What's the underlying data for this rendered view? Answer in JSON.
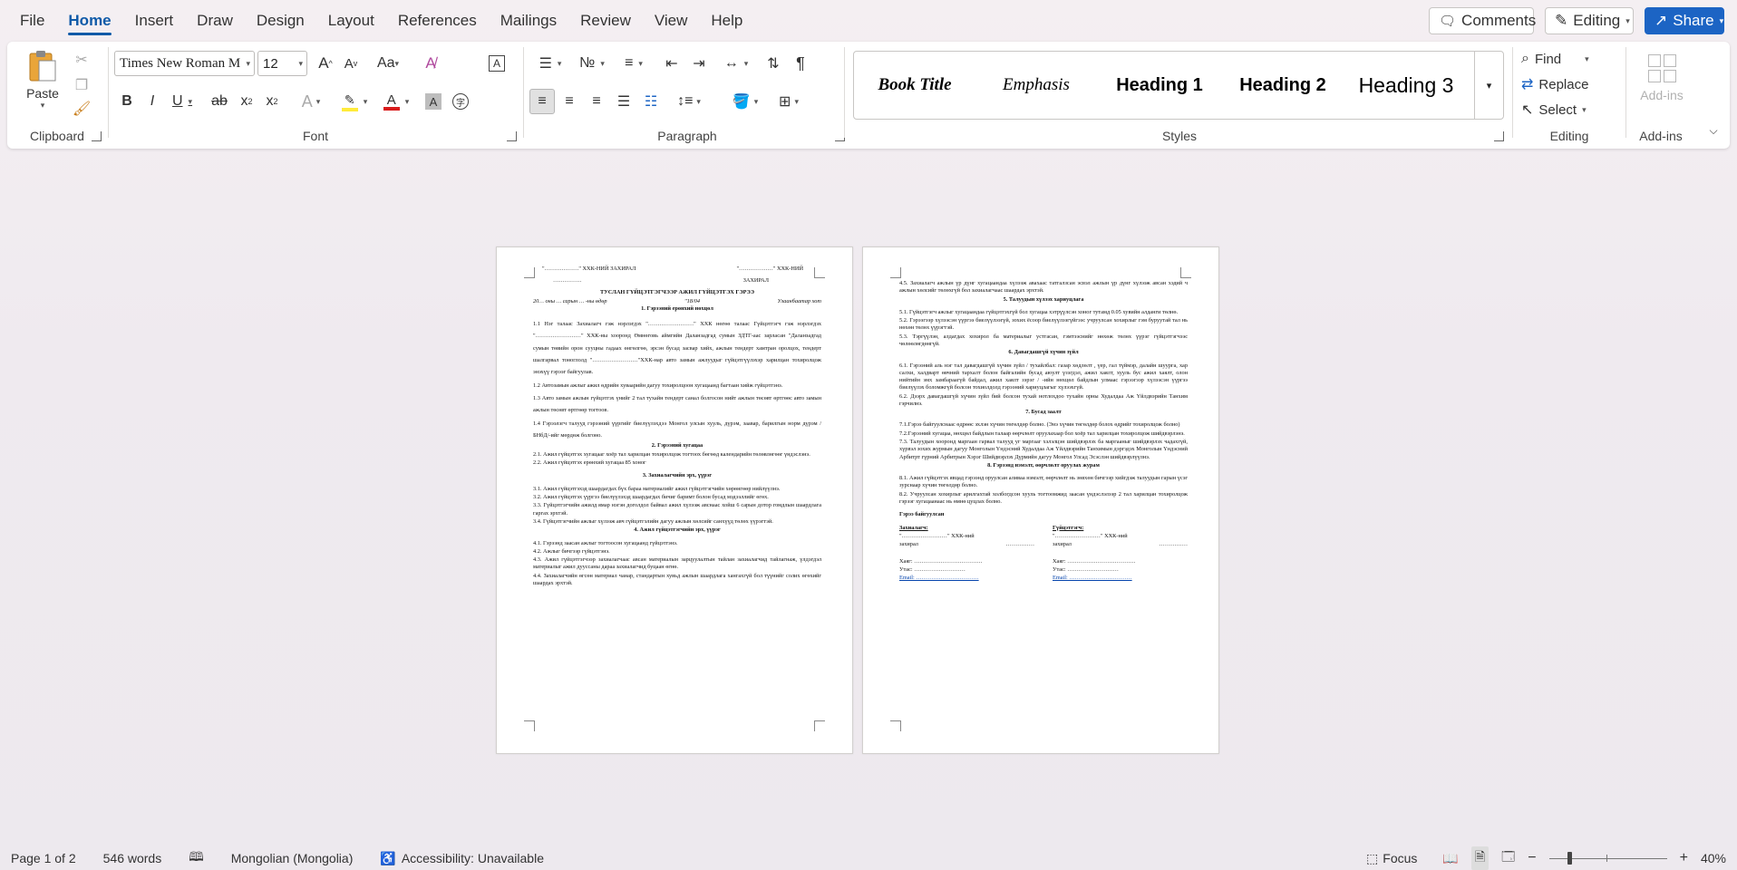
{
  "menu": {
    "tabs": [
      "File",
      "Home",
      "Insert",
      "Draw",
      "Design",
      "Layout",
      "References",
      "Mailings",
      "Review",
      "View",
      "Help"
    ],
    "active": "Home"
  },
  "actions": {
    "comments": "Comments",
    "editing": "Editing",
    "share": "Share"
  },
  "ribbon": {
    "clipboard": {
      "label": "Clipboard",
      "paste": "Paste"
    },
    "font": {
      "label": "Font",
      "name": "Times New Roman M",
      "size": "12"
    },
    "paragraph": {
      "label": "Paragraph"
    },
    "styles": {
      "label": "Styles",
      "items": [
        "Book Title",
        "Emphasis",
        "Heading 1",
        "Heading 2",
        "Heading 3"
      ]
    },
    "editing": {
      "label": "Editing",
      "find": "Find",
      "replace": "Replace",
      "select": "Select"
    },
    "addins": {
      "label": "Add-ins",
      "button": "Add-ins"
    }
  },
  "status": {
    "page": "Page 1 of 2",
    "words": "546 words",
    "language": "Mongolian (Mongolia)",
    "accessibility": "Accessibility: Unavailable",
    "focus": "Focus",
    "zoom": "40%"
  },
  "page1": {
    "top_left": "\"………………\" ХХК-НИЙ ЗАХИРАЛ",
    "top_right": "\"………………\" ХХК-НИЙ",
    "top_right2": "ЗАХИРАЛ",
    "sign_line": "……………",
    "title": "ТУСЛАН ГҮЙЦЭТГЭГЧЭЭР АЖИЛ ГҮЙЦЭТГЭХ ГЭРЭЭ",
    "date_line_left": "20… оны … сарын … -ны өдөр",
    "date_line_mid": "\"18/04",
    "date_line_right": "Улаанбаатар хот",
    "s1": "1.   Гэрээний ерөнхий нөхцөл",
    "p1_1": "1.1      Нэг талаас Захиалагч гэж нэрлэгдэх \"……………………\" ХХК нөгөө талаас Гүйцэтгэгч гэж нэрлэгдэх \"……………………\" ХХК-ны хооронд Өмнөговь аймгийн Даланзадгад сумын ЗДТГ-аас зарласан \"Даланзадгад сумын төвийн орон сууцны гадаах өнгөлгөө, эрсэн бусад засвар хийх, ажлын тендерт хамтран оролцох, тендерт шалгарвал тоноглолд \"……………………\"ХХК-нар авто замын ажлуудыг гүйцэтгүүлэхэр харилцан тохиролцож энэхүү гэрээг байгуулав.",
    "p1_2": "1.2      Автозамын ажлыг ажил өдрийн хуваарийн дагуу тохиролцоон хугацаанд багтаан хийж гүйцэтгэнэ.",
    "p1_3": "1.3      Авто замын ажлын гүйцэтгэх үнийг 2 тал тухайн тендерт санал болгосон нийт ажлын төсөвт өртгөөс авто замын ажлын төсөвт өртгөөр тогтоов.",
    "p1_4": "1.4      Гэрээлэгч талууд гэрээний үүргийг биелүүлэхдээ Монгол улсын хууль, дүрэм, заавар, барилгын норм дүрэм /БНбД/-ийг мөрдөж болгоно.",
    "s2": "2. Гэрээний хугацаа",
    "p2_1": "2.1. Ажил гүйцэтгэх хугацааг хоёр тал харилцан тохиролцож тогтоох бөгөөд календарийн төлөвлөгөөг үндэслэнэ.",
    "p2_2": "2.2. Ажил гүйцэтгэх ерөнхий хугацаа 85 хоног",
    "s3": "3. Захиалагчийн эрх, үүрэг",
    "p3_1": "3.1. Ажил гүйцэтгэхэд шаардагдах бүх бараа материалийг ажил гүйцэтгэгчийн хөрөнгөөр нийлүүлнэ.",
    "p3_2": "3.2. Ажил гүйцэтгэх үүргээ биелүүлэхэд шаардагдах бичиг баримт болон бусад мэдээллийг өгөх.",
    "p3_3": "3.3. Гүйцэтгэгчийн ажилд ямар нэгэн доголдол байвал ажил хүлээж авснаас хойш 6 сарын дотор гомдлын шаардлага гаргах эрхтэй.",
    "p3_4": "3.4. Гүйцэтгэгчийн ажлыг хүлээж авч гүйцэтгэлийн дагуу ажлын хөлсийг санхүүд төлөх үүрэгтэй.",
    "s4": "4. Ажил гүйцэтгэгчийн эрх, үүрэг",
    "p4_1": "4.1. Гэрээнд заасан ажлыг тогтоосон хугацаанд гүйцэтгэнэ.",
    "p4_2": "4.2. Ажлыг бичгээр гүйцэтгэнэ.",
    "p4_3": "4.3. Ажил гүйцэтгэгчээр захиалагчаас авсан материалын зарцуулалтын тайлан захиалагчид тайлагнаж, үлдэгдэл материалыг ажил дууссаны дараа захиалагчид буцаан өгнө.",
    "p4_4": "4.4. Захиалагчийн өгсөн материал чанар, стандартын хувьд ажлын шаардлага хангахгүй бол түүнийг солих өгөхийг шаардах эрхтэй."
  },
  "page2": {
    "p4_5": "4.5. Захиалагч ажлын үр дүнг хугацаандаа хүлээж авахаас татгалзсан эсвэл ажлын үр дүнг хүлээж авсан хэдий ч ажлын хөлсийг төлөхгүй бол захиалагчаас шаардах эрхтэй.",
    "s5": "5. Талуудын хүлээх хариуцлага",
    "p5_1": "5.1. Гүйцэтгэгч ажлыг хугацаандаа гүйцэтгэхгүй бол хугацаа хэтрүүлсэн хоног тутамд 0.05 хувийн алданги төлнө.",
    "p5_2": "5.2. Гэрээгээр хүлээсэн үүргээ биелүүлээгүй, зохих ёсоор биелүүлээгүйгээс учруулсан хохирлыг гэм буруутай тал нь нөхөн төлөх үүрэгтэй.",
    "p5_3": "5.3. Тэргүүлэн, алдагдах хохирол ба материалыг устгасан, гэмтээснийг нөхөж төлөх үүрэг гүйцэтгэгчээс чөлөөлөгдөнгүй.",
    "s6": "6. Давагдашгүй хүчин зүйл",
    "p6_1": "6.1. Гэрээний аль нэг тал давагдашгүй хүчин зүйл / тухайлбал: газар хөдлөлт , үер, гал түймэр, далайн шуурга, хар салхи, халдварт өвчний тархалт болон байгалийн бусад аюулт үзэгдэл, ажил хаялт, хууль бус ажил хаялт, олон нийтийн эмх замбараагүй байдал, ажил хаялт зэрэг / -ийн нөхцөл байдлын улмаас гэрээгээр хүлээсэн үүргээ биелүүлэх боломжгүй болсон тохиолдолд гэрээний хариуцлагыг хүлээхгүй.",
    "p6_2": "6.2. Дээрх давагдашгүй хүчин зүйл бий болсон тухай нотлохдоо тухайн орны Худалдаа Аж Үйлдвэрийн Танхим гэрчилнэ.",
    "s7": "7. Бусад заалт",
    "p7_1": "7.1.Гэрээ байгуулснаас өдрөөс эхлэн хүчин төгөлдөр болно. (Энэ хүчин төгөлдөр болох өдрийг тохиролцож болно)",
    "p7_2": "7.2.Гэрээний хугацаа, нөхцөл байдлын талаар өөрчлөлт оруулахаар бол хоёр тал харилцан тохиролцож шийдвэрлэнэ.",
    "p7_3": "7.3. Талуудын хооронд маргаан гарвал талууд уг маргааг хэлэлцэн шийдвэрлэх ба маргааныг шийдвэрлэх чадахгүй, хүрвэл зохих журмын дагуу Монголын Үндэсний Худалдаа Аж Үйлдвэрийн Танхимын дэргэдэх Монголын Үндэсний Арбитрт гүрний Арбитрын Хэрэг Шийдвэрлэх Дүрмийн дагуу Монгол Улсад Эсэслэн шийдвэрлүүлнэ.",
    "s8": "8. Гэрээнд нэмэлт, өөрчлөлт оруулах журам",
    "p8_1": "8.1. Ажил гүйцэтгэх явцад гэрээнд оруулсан аливаа нэмэлт, өөрчлөлт нь зөвхөн бичгээр хийгдэж талуудын гарын үсэг зурснаар хүчин төгөлдөр болно.",
    "p8_2": "8.2. Учруулсан хохирлыг арилгахтай холбогдсон хууль тогтоомжид заасан үндэслэлээр 2 тал харилцан тохиролцож гэрээг хугацаанаас нь өмнө цуцлах болно.",
    "sign_title": "Гэрээ байгуулсан",
    "col_left_head": "Захиалагч:",
    "col_right_head": "Гүйцэтгэгч:",
    "company_line": "\"……………………\" ХХК-ний",
    "director": "захирал",
    "dots": "……………",
    "addr": "Хаяг: ………………………………",
    "phone": "Утас: ………………………",
    "email": "Email: ……………………………"
  }
}
